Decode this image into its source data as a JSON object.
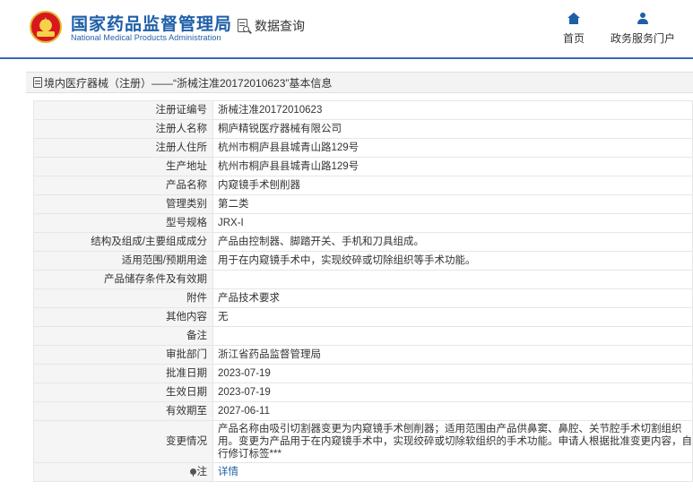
{
  "header": {
    "brand_cn": "国家药品监督管理局",
    "brand_en": "National Medical Products Administration",
    "query_label": "数据查询",
    "nav": [
      {
        "label": "首页",
        "icon": "home-icon"
      },
      {
        "label": "政务服务门户",
        "icon": "user-icon"
      }
    ]
  },
  "page_title": "境内医疗器械（注册）——“浙械注准20172010623”基本信息",
  "rows": [
    {
      "key": "注册证编号",
      "value": "浙械注准20172010623"
    },
    {
      "key": "注册人名称",
      "value": "桐庐精锐医疗器械有限公司"
    },
    {
      "key": "注册人住所",
      "value": "杭州市桐庐县县城青山路129号"
    },
    {
      "key": "生产地址",
      "value": "杭州市桐庐县县城青山路129号"
    },
    {
      "key": "产品名称",
      "value": "内窥镜手术刨削器"
    },
    {
      "key": "管理类别",
      "value": "第二类"
    },
    {
      "key": "型号规格",
      "value": "JRX-I"
    },
    {
      "key": "结构及组成/主要组成成分",
      "value": "产品由控制器、脚踏开关、手机和刀具组成。"
    },
    {
      "key": "适用范围/预期用途",
      "value": "用于在内窥镜手术中，实现绞碎或切除组织等手术功能。"
    },
    {
      "key": "产品储存条件及有效期",
      "value": ""
    },
    {
      "key": "附件",
      "value": "产品技术要求"
    },
    {
      "key": "其他内容",
      "value": "无"
    },
    {
      "key": "备注",
      "value": ""
    },
    {
      "key": "审批部门",
      "value": "浙江省药品监督管理局"
    },
    {
      "key": "批准日期",
      "value": "2023-07-19"
    },
    {
      "key": "生效日期",
      "value": "2023-07-19"
    },
    {
      "key": "有效期至",
      "value": "2027-06-11"
    },
    {
      "key": "变更情况",
      "value": "产品名称由吸引切割器变更为内窥镜手术刨削器；适用范围由产品供鼻窦、鼻腔、关节腔手术切割组织用。变更为产品用于在内窥镜手术中，实现绞碎或切除软组织的手术功能。申请人根据批准变更内容，自行修订标签***"
    }
  ],
  "note_row": {
    "key": "注",
    "value": "详情",
    "icon": "pin-icon"
  }
}
